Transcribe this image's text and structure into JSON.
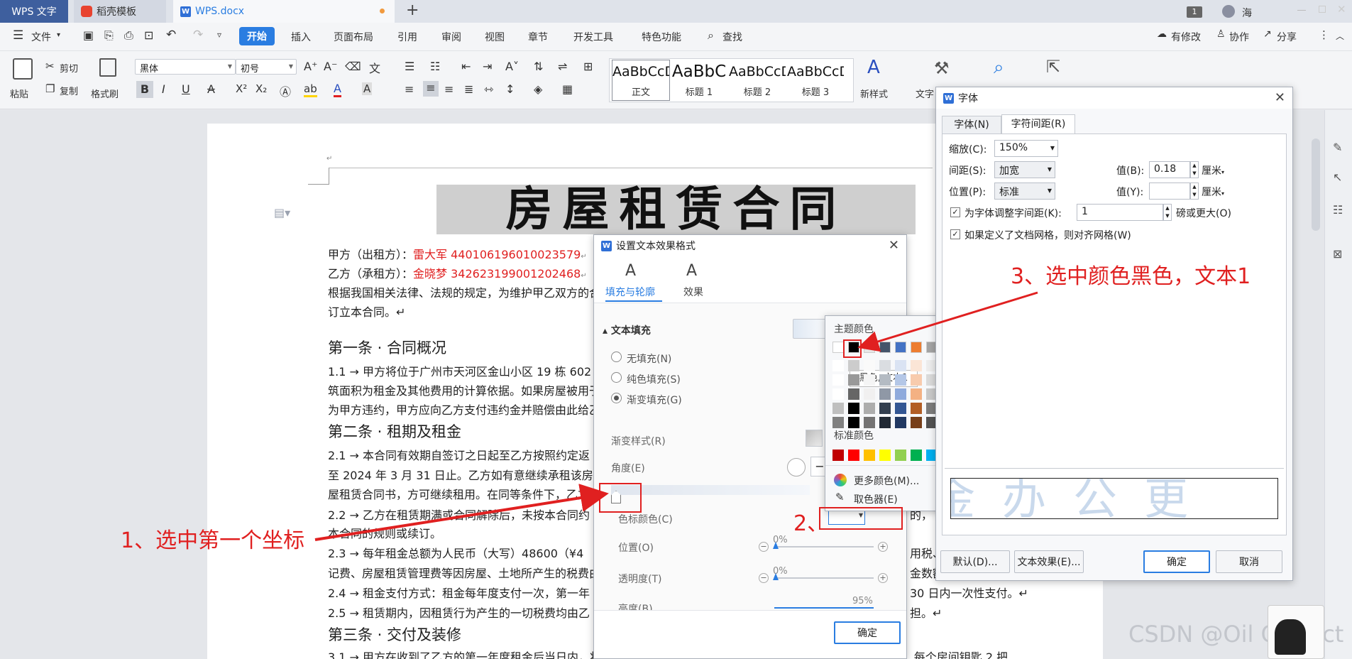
{
  "titlebar": {
    "tabs": [
      {
        "label": "WPS 文字"
      },
      {
        "label": "稻壳模板"
      },
      {
        "label": "WPS.docx"
      }
    ],
    "new_tab": "+",
    "badge": "1",
    "user": "海"
  },
  "menu": {
    "file": "文件",
    "items": [
      "开始",
      "插入",
      "页面布局",
      "引用",
      "审阅",
      "视图",
      "章节",
      "开发工具",
      "特色功能"
    ],
    "search": "查找",
    "right": [
      "有修改",
      "协作",
      "分享"
    ]
  },
  "ribbon": {
    "paste": "粘贴",
    "cut": "剪切",
    "copy": "复制",
    "format_painter": "格式刷",
    "font_name": "黑体",
    "font_size": "初号",
    "styles": [
      {
        "preview": "AaBbCcD",
        "label": "正文"
      },
      {
        "preview": "AaBbC",
        "label": "标题 1"
      },
      {
        "preview": "AaBbCcD",
        "label": "标题 2"
      },
      {
        "preview": "AaBbCcD",
        "label": "标题 3"
      }
    ],
    "new_style": "新样式",
    "text_tools": "文字"
  },
  "document": {
    "title": "房屋租赁合同",
    "lines": [
      {
        "prefix": "甲方（出租方）：",
        "red": "雷大军 440106196010023579",
        "suffix": "↵"
      },
      {
        "prefix": "乙方（承租方）：",
        "red": "金晓梦 342623199001202468",
        "suffix": "↵"
      },
      {
        "prefix": "根据我国相关法律、法规的规定，为维护甲乙双方的合",
        "red": "",
        "suffix": ""
      },
      {
        "prefix": "订立本合同。↵",
        "red": "",
        "suffix": ""
      }
    ],
    "article1": "第一条 · 合同概况",
    "a1_lines": [
      "1.1 →  甲方将位于广州市天河区金山小区 19 栋 602",
      "筑面积为租金及其他费用的计算依据。如果房屋被用于",
      "为甲方违约，甲方应向乙方支付违约金并赔偿由此给乙"
    ],
    "article2": "第二条 · 租期及租金",
    "a2_lines": [
      "2.1 →  本合同有效期自签订之日起至乙方按照约定返",
      "至 2024 年 3 月 31 日止。乙方如有意继续承租该房屋",
      "屋租赁合同书，方可继续租用。在同等条件下，乙方享",
      "2.2 →  乙方在租赁期满或合同解除后，未按本合同约",
      "本合同的规则或续订。",
      "2.3 →  每年租金总额为人民币（大写）48600（¥4",
      "记费、房屋租赁管理费等因房屋、土地所产生的税费由",
      "2.4 →  租金支付方式：租金每年度支付一次，第一年",
      "2.5 →  租赁期内，因租赁行为产生的一切税费均由乙"
    ],
    "a2_tail": [
      "的，",
      "用税、",
      "金数额",
      "30 日内一次性支付。↵",
      "担。↵"
    ],
    "article3": "第三条 · 交付及装修",
    "a3_line": "3.1 →  甲方在收到了乙方的第一年度租金后当日内，将租赁物业交付乙方使用（入户门禁卡 1 张，入户门钥匙 4 把，每个房间钥匙 2 把"
  },
  "text_effect_dialog": {
    "title": "设置文本效果格式",
    "tabs": [
      "填充与轮廓",
      "效果"
    ],
    "section": "文本填充",
    "options": [
      "无填充(N)",
      "纯色填充(S)",
      "渐变填充(G)"
    ],
    "gradient_style": "渐变样式(R)",
    "angle": "角度(E)",
    "stop_color": "色标颜色(C)",
    "position": "位置(O)",
    "position_value": "0%",
    "transparency": "透明度(T)",
    "transparency_value": "0%",
    "brightness": "亮度(B)",
    "brightness_value": "95%",
    "ok": "确定"
  },
  "color_picker": {
    "theme_title": "主题颜色",
    "tooltip": "黑色, 文本1",
    "standard_title": "标准颜色",
    "more_colors": "更多颜色(M)...",
    "eyedropper": "取色器(E)",
    "theme_row": [
      "#ffffff",
      "#000000",
      "#e7e6e6",
      "#44546a",
      "#4472c4",
      "#ed7d31",
      "#a5a5a5",
      "#ffc000",
      "#5b9bd5",
      "#70ad47"
    ],
    "standard": [
      "#c00000",
      "#ff0000",
      "#ffc000",
      "#ffff00",
      "#92d050",
      "#00b050",
      "#00b0f0",
      "#0070c0",
      "#002060",
      "#7030a0"
    ]
  },
  "font_dialog": {
    "title": "字体",
    "tabs": [
      "字体(N)",
      "字符间距(R)"
    ],
    "scale_label": "缩放(C):",
    "scale_value": "150%",
    "spacing_label": "间距(S):",
    "spacing_value": "加宽",
    "value_b_label": "值(B):",
    "value_b": "0.18",
    "unit_b": "厘米",
    "position_label": "位置(P):",
    "position_value": "标准",
    "value_y_label": "值(Y):",
    "value_y": "",
    "unit_y": "厘米",
    "kerning_label": "为字体调整字间距(K):",
    "kerning_value": "1",
    "kerning_suffix": "磅或更大(O)",
    "grid_label": "如果定义了文档网格，则对齐网格(W)",
    "preview": "金办公更",
    "default_btn": "默认(D)...",
    "text_effect_btn": "文本效果(E)...",
    "ok": "确定",
    "cancel": "取消"
  },
  "annotations": {
    "step1": "1、选中第一个坐标",
    "step2": "2、",
    "step3": "3、选中颜色黑色，文本1"
  },
  "watermark": "CSDN @Oil Correct",
  "accent": "#2a7de1",
  "annotation_color": "#e02020"
}
